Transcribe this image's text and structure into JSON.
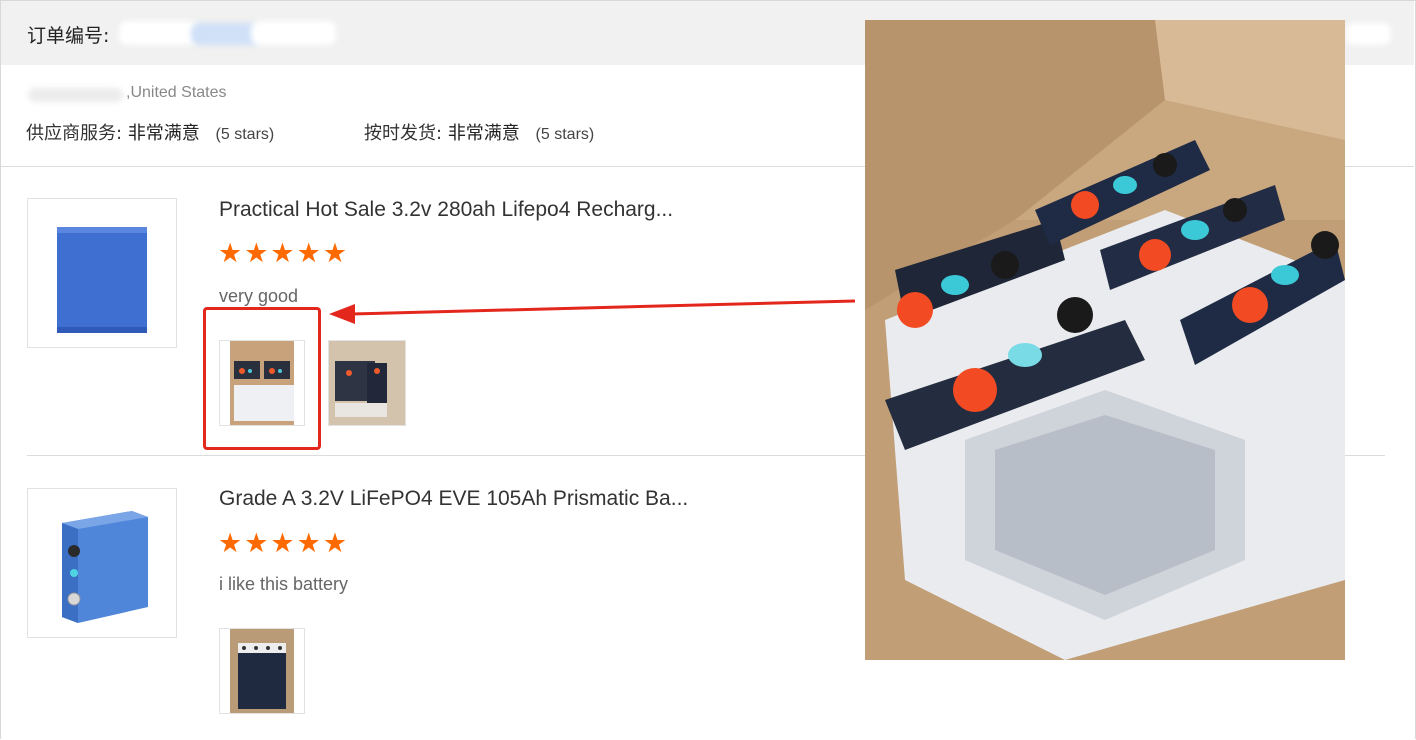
{
  "order": {
    "label": "订单编号:",
    "address_suffix": ",United States"
  },
  "ratings": [
    {
      "label": "供应商服务:",
      "value": "非常满意",
      "stars": "(5 stars)"
    },
    {
      "label": "按时发货:",
      "value": "非常满意",
      "stars": "(5 stars)"
    }
  ],
  "products": [
    {
      "title": "Practical Hot Sale 3.2v 280ah Lifepo4 Recharg...",
      "rating": "★★★★★",
      "review": "very good",
      "images": [
        "battery-box-photo",
        "battery-box-photo-2"
      ]
    },
    {
      "title": "Grade A 3.2V LiFePO4 EVE 105Ah Prismatic Ba...",
      "rating": "★★★★★",
      "review": "i like this battery",
      "images": [
        "battery-pack-photo"
      ]
    }
  ],
  "colors": {
    "star": "#ff6a00",
    "highlight": "#e3271c",
    "header_bg": "#f1f1f1"
  }
}
